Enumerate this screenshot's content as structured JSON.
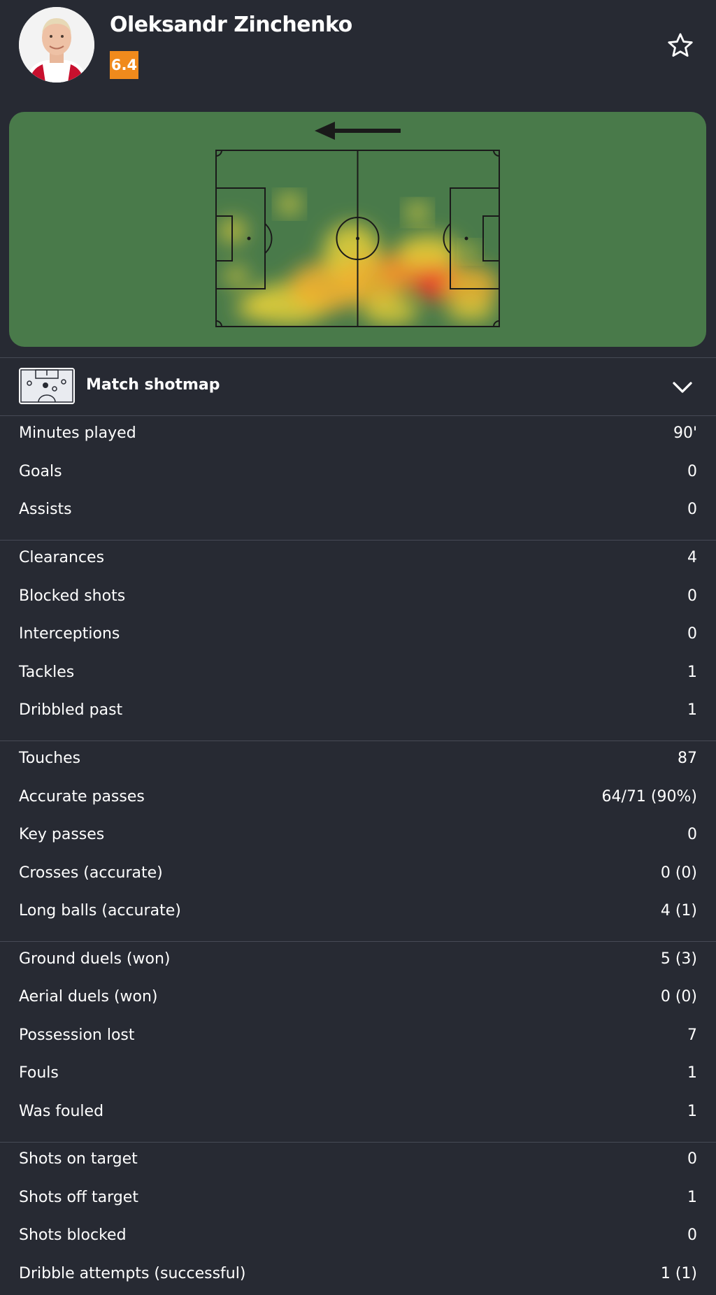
{
  "player": {
    "name": "Oleksandr Zinchenko",
    "rating": "6.4",
    "rating_color": "#f08a1c"
  },
  "header": {
    "favorite_icon": "star-outline-icon"
  },
  "heatmap": {
    "attack_direction": "left",
    "pitch_color": "#497a4a"
  },
  "shotmap": {
    "label": "Match shotmap",
    "expand_icon": "chevron-down-icon"
  },
  "stat_groups": [
    [
      {
        "label": "Minutes played",
        "value": "90'"
      },
      {
        "label": "Goals",
        "value": "0"
      },
      {
        "label": "Assists",
        "value": "0"
      }
    ],
    [
      {
        "label": "Clearances",
        "value": "4"
      },
      {
        "label": "Blocked shots",
        "value": "0"
      },
      {
        "label": "Interceptions",
        "value": "0"
      },
      {
        "label": "Tackles",
        "value": "1"
      },
      {
        "label": "Dribbled past",
        "value": "1"
      }
    ],
    [
      {
        "label": "Touches",
        "value": "87"
      },
      {
        "label": "Accurate passes",
        "value": "64/71 (90%)"
      },
      {
        "label": "Key passes",
        "value": "0"
      },
      {
        "label": "Crosses (accurate)",
        "value": "0 (0)"
      },
      {
        "label": "Long balls (accurate)",
        "value": "4 (1)"
      }
    ],
    [
      {
        "label": "Ground duels (won)",
        "value": "5 (3)"
      },
      {
        "label": "Aerial duels (won)",
        "value": "0 (0)"
      },
      {
        "label": "Possession lost",
        "value": "7"
      },
      {
        "label": "Fouls",
        "value": "1"
      },
      {
        "label": "Was fouled",
        "value": "1"
      }
    ],
    [
      {
        "label": "Shots on target",
        "value": "0"
      },
      {
        "label": "Shots off target",
        "value": "1"
      },
      {
        "label": "Shots blocked",
        "value": "0"
      },
      {
        "label": "Dribble attempts (successful)",
        "value": "1 (1)"
      }
    ]
  ]
}
